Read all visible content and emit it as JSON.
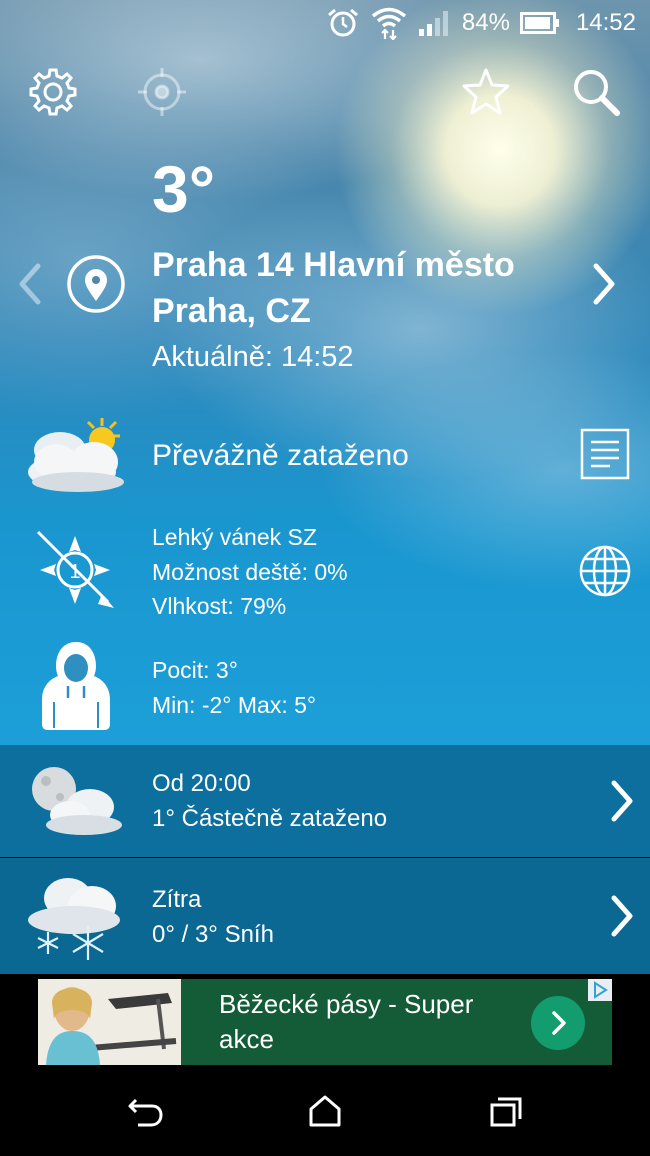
{
  "status": {
    "battery": "84%",
    "time": "14:52"
  },
  "weather": {
    "temperature": "3°",
    "location_line1": "Praha 14 Hlavní město",
    "location_line2": "Praha, CZ",
    "updated": "Aktuálně: 14:52",
    "condition": "Převážně zataženo",
    "wind": "Lehký vánek SZ",
    "rain_chance": "Možnost deště: 0%",
    "humidity": "Vlhkost: 79%",
    "wind_force": "1",
    "feels_like": "Pocit: 3°",
    "min_max": "Min: -2° Max: 5°"
  },
  "forecast": [
    {
      "title": "Od 20:00",
      "desc": "1° Částečně zataženo"
    },
    {
      "title": "Zítra",
      "desc": "0° / 3° Sníh"
    }
  ],
  "ad": {
    "text": "Běžecké pásy - Super akce"
  },
  "colors": {
    "forecast_row1": "#0c6f9d",
    "forecast_row2": "#0b6892",
    "ad_bg": "#145c38",
    "ad_button": "#139c6e"
  }
}
